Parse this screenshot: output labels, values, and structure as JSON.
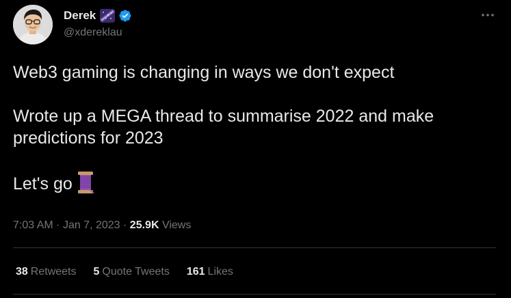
{
  "author": {
    "display_name": "Derek",
    "handle": "@xdereklau",
    "name_emoji_icon": "milky-way-emoji",
    "verified_icon": "verified-badge-icon",
    "badge_color": "#1d9bf0"
  },
  "menu": {
    "more_icon": "more-horizontal-icon"
  },
  "tweet": {
    "lines": [
      "Web3 gaming is changing in ways we don't expect",
      "Wrote up a MEGA thread to summarise 2022 and make predictions for 2023",
      "Let's go"
    ],
    "trailing_emoji_icon": "thread-spool-emoji"
  },
  "meta": {
    "time": "7:03 AM",
    "separator": "·",
    "date": "Jan 7, 2023",
    "views_count": "25.9K",
    "views_label": "Views"
  },
  "stats": {
    "retweets_count": "38",
    "retweets_label": "Retweets",
    "quotes_count": "5",
    "quotes_label": "Quote Tweets",
    "likes_count": "161",
    "likes_label": "Likes"
  },
  "colors": {
    "background": "#000000",
    "text_primary": "#e7e9ea",
    "text_secondary": "#71767b",
    "divider": "#2f3336"
  }
}
